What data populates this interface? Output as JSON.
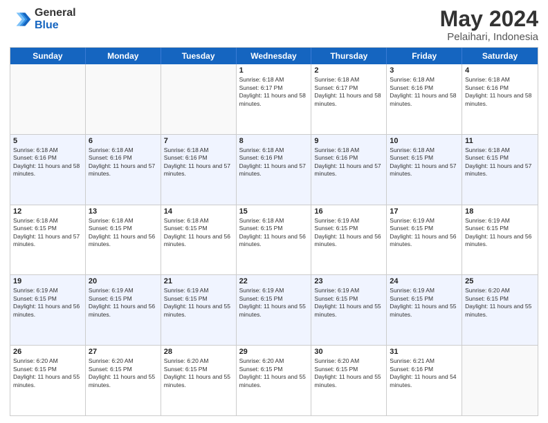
{
  "header": {
    "logo_general": "General",
    "logo_blue": "Blue",
    "title": "May 2024",
    "location": "Pelaihari, Indonesia"
  },
  "days_of_week": [
    "Sunday",
    "Monday",
    "Tuesday",
    "Wednesday",
    "Thursday",
    "Friday",
    "Saturday"
  ],
  "rows": [
    {
      "cells": [
        {
          "day": "",
          "empty": true
        },
        {
          "day": "",
          "empty": true
        },
        {
          "day": "",
          "empty": true
        },
        {
          "day": "1",
          "sunrise": "6:18 AM",
          "sunset": "6:17 PM",
          "daylight": "11 hours and 58 minutes."
        },
        {
          "day": "2",
          "sunrise": "6:18 AM",
          "sunset": "6:17 PM",
          "daylight": "11 hours and 58 minutes."
        },
        {
          "day": "3",
          "sunrise": "6:18 AM",
          "sunset": "6:16 PM",
          "daylight": "11 hours and 58 minutes."
        },
        {
          "day": "4",
          "sunrise": "6:18 AM",
          "sunset": "6:16 PM",
          "daylight": "11 hours and 58 minutes."
        }
      ]
    },
    {
      "alt": true,
      "cells": [
        {
          "day": "5",
          "sunrise": "6:18 AM",
          "sunset": "6:16 PM",
          "daylight": "11 hours and 58 minutes."
        },
        {
          "day": "6",
          "sunrise": "6:18 AM",
          "sunset": "6:16 PM",
          "daylight": "11 hours and 57 minutes."
        },
        {
          "day": "7",
          "sunrise": "6:18 AM",
          "sunset": "6:16 PM",
          "daylight": "11 hours and 57 minutes."
        },
        {
          "day": "8",
          "sunrise": "6:18 AM",
          "sunset": "6:16 PM",
          "daylight": "11 hours and 57 minutes."
        },
        {
          "day": "9",
          "sunrise": "6:18 AM",
          "sunset": "6:16 PM",
          "daylight": "11 hours and 57 minutes."
        },
        {
          "day": "10",
          "sunrise": "6:18 AM",
          "sunset": "6:15 PM",
          "daylight": "11 hours and 57 minutes."
        },
        {
          "day": "11",
          "sunrise": "6:18 AM",
          "sunset": "6:15 PM",
          "daylight": "11 hours and 57 minutes."
        }
      ]
    },
    {
      "cells": [
        {
          "day": "12",
          "sunrise": "6:18 AM",
          "sunset": "6:15 PM",
          "daylight": "11 hours and 57 minutes."
        },
        {
          "day": "13",
          "sunrise": "6:18 AM",
          "sunset": "6:15 PM",
          "daylight": "11 hours and 56 minutes."
        },
        {
          "day": "14",
          "sunrise": "6:18 AM",
          "sunset": "6:15 PM",
          "daylight": "11 hours and 56 minutes."
        },
        {
          "day": "15",
          "sunrise": "6:18 AM",
          "sunset": "6:15 PM",
          "daylight": "11 hours and 56 minutes."
        },
        {
          "day": "16",
          "sunrise": "6:19 AM",
          "sunset": "6:15 PM",
          "daylight": "11 hours and 56 minutes."
        },
        {
          "day": "17",
          "sunrise": "6:19 AM",
          "sunset": "6:15 PM",
          "daylight": "11 hours and 56 minutes."
        },
        {
          "day": "18",
          "sunrise": "6:19 AM",
          "sunset": "6:15 PM",
          "daylight": "11 hours and 56 minutes."
        }
      ]
    },
    {
      "alt": true,
      "cells": [
        {
          "day": "19",
          "sunrise": "6:19 AM",
          "sunset": "6:15 PM",
          "daylight": "11 hours and 56 minutes."
        },
        {
          "day": "20",
          "sunrise": "6:19 AM",
          "sunset": "6:15 PM",
          "daylight": "11 hours and 56 minutes."
        },
        {
          "day": "21",
          "sunrise": "6:19 AM",
          "sunset": "6:15 PM",
          "daylight": "11 hours and 55 minutes."
        },
        {
          "day": "22",
          "sunrise": "6:19 AM",
          "sunset": "6:15 PM",
          "daylight": "11 hours and 55 minutes."
        },
        {
          "day": "23",
          "sunrise": "6:19 AM",
          "sunset": "6:15 PM",
          "daylight": "11 hours and 55 minutes."
        },
        {
          "day": "24",
          "sunrise": "6:19 AM",
          "sunset": "6:15 PM",
          "daylight": "11 hours and 55 minutes."
        },
        {
          "day": "25",
          "sunrise": "6:20 AM",
          "sunset": "6:15 PM",
          "daylight": "11 hours and 55 minutes."
        }
      ]
    },
    {
      "cells": [
        {
          "day": "26",
          "sunrise": "6:20 AM",
          "sunset": "6:15 PM",
          "daylight": "11 hours and 55 minutes."
        },
        {
          "day": "27",
          "sunrise": "6:20 AM",
          "sunset": "6:15 PM",
          "daylight": "11 hours and 55 minutes."
        },
        {
          "day": "28",
          "sunrise": "6:20 AM",
          "sunset": "6:15 PM",
          "daylight": "11 hours and 55 minutes."
        },
        {
          "day": "29",
          "sunrise": "6:20 AM",
          "sunset": "6:15 PM",
          "daylight": "11 hours and 55 minutes."
        },
        {
          "day": "30",
          "sunrise": "6:20 AM",
          "sunset": "6:15 PM",
          "daylight": "11 hours and 55 minutes."
        },
        {
          "day": "31",
          "sunrise": "6:21 AM",
          "sunset": "6:16 PM",
          "daylight": "11 hours and 54 minutes."
        },
        {
          "day": "",
          "empty": true
        }
      ]
    }
  ]
}
